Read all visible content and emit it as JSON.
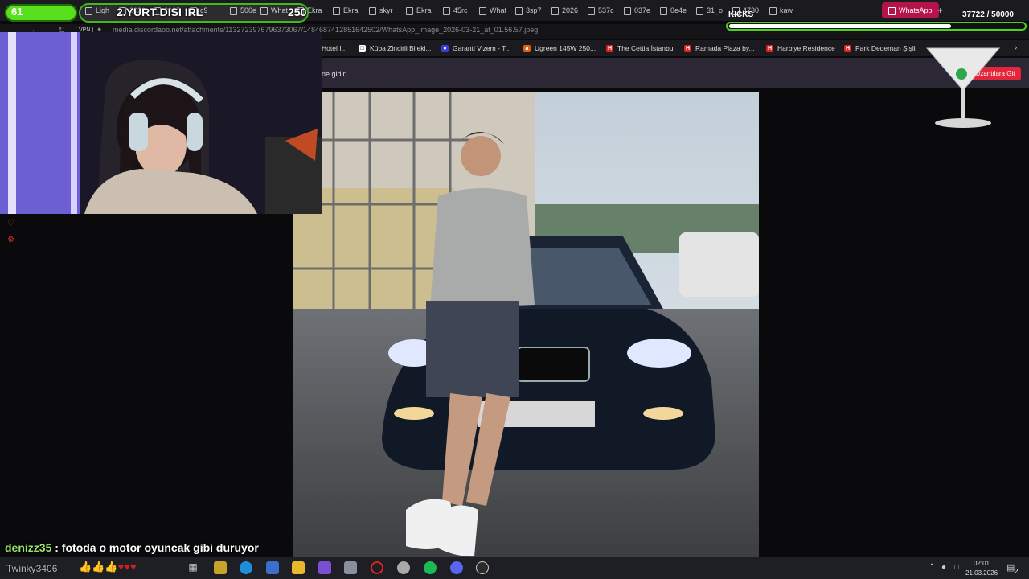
{
  "browser": {
    "tabs": [
      {
        "label": "Ligh"
      },
      {
        "label": "2026"
      },
      {
        "label": "2025"
      },
      {
        "label": "c9"
      },
      {
        "label": "500e"
      },
      {
        "label": "What"
      },
      {
        "label": "Ekra"
      },
      {
        "label": "Ekra"
      },
      {
        "label": "skyr"
      },
      {
        "label": "Ekra"
      },
      {
        "label": "45rc"
      },
      {
        "label": "What"
      },
      {
        "label": "3sp7"
      },
      {
        "label": "2026"
      },
      {
        "label": "537c"
      },
      {
        "label": "037e"
      },
      {
        "label": "0e4e"
      },
      {
        "label": "31_o"
      },
      {
        "label": "4730"
      },
      {
        "label": "kaw"
      }
    ],
    "active_tab": {
      "label": "WhatsApp"
    },
    "new_tab_symbol": "+",
    "vpn_label": "VPN",
    "url": "media.discordapp.net/attachments/1132723976796373067/1484687412851642502/WhatsApp_Image_2026-03-21_at_01.56.57.jpeg",
    "info_text": "ne gidin.",
    "extensions_button": "Uzantılara Git",
    "bookmarks": [
      {
        "label": "Hotel I..."
      },
      {
        "label": "Küba Zincirli Bilekl..."
      },
      {
        "label": "Garanti Vizem - T..."
      },
      {
        "label": "Ugreen 145W 250..."
      },
      {
        "label": "The Cettia İstanbul"
      },
      {
        "label": "Ramada Plaza by..."
      },
      {
        "label": "Harbiye Residence"
      },
      {
        "label": "Park Dedeman Şişli"
      }
    ]
  },
  "overlay": {
    "level": "61",
    "goal_title": "2.YURT DISI IRL",
    "goal_count": "250",
    "kicks_label": "KICKS",
    "kicks_count": "37722  / 50000",
    "kicks_progress": 0.754,
    "chat": {
      "user": "denizz35",
      "separator": " : ",
      "message": "fotoda o motor oyuncak gibi duruyor"
    },
    "sub_user": "Twinky3406"
  },
  "taskbar": {
    "time": "02:01",
    "date": "21.03.2026",
    "notifications": "2",
    "icons": [
      "start-icon",
      "task-view-icon",
      "app-icon",
      "edge-icon",
      "store-icon",
      "explorer-icon",
      "app-icon-2",
      "app-icon-3",
      "opera-icon",
      "app-icon-4",
      "spotify-icon",
      "discord-icon",
      "obs-icon"
    ]
  },
  "colors": {
    "accent_green": "#58e01c",
    "active_tab": "#b5144a",
    "extension_button": "#e5263a",
    "chat_username": "#9be26a"
  }
}
